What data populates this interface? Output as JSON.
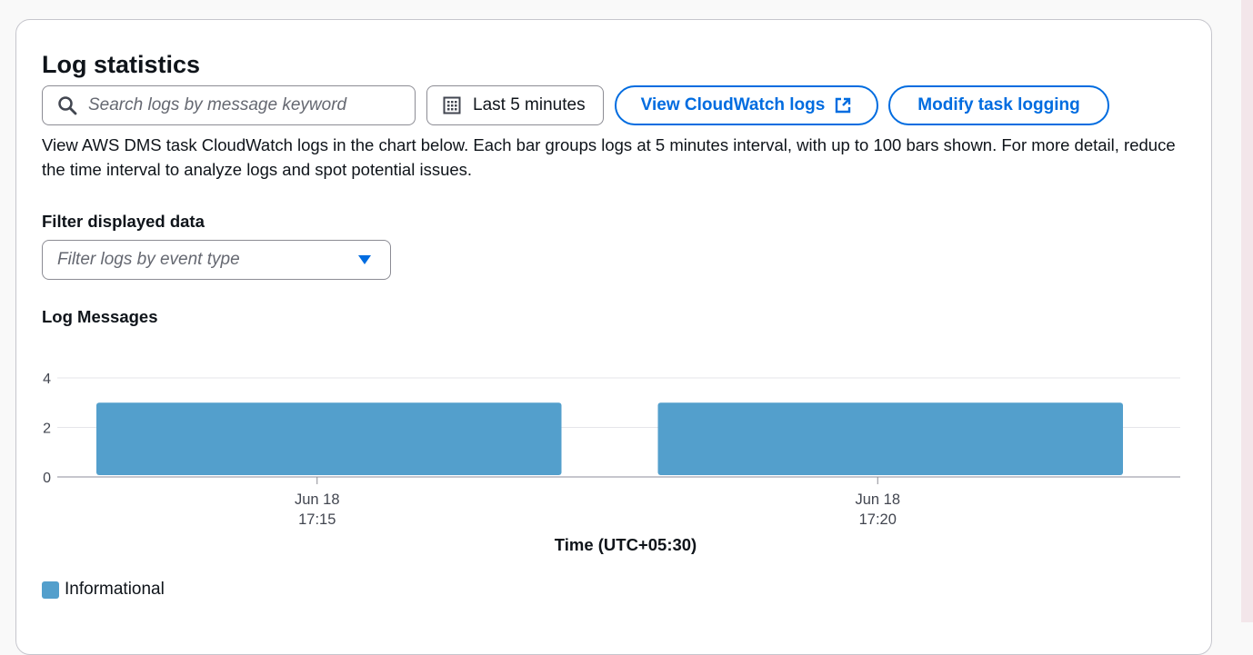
{
  "panel": {
    "title": "Log statistics",
    "description": "View AWS DMS task CloudWatch logs in the chart below. Each bar groups logs at 5 minutes interval, with up to 100 bars shown. For more detail, reduce the time interval to analyze logs and spot potential issues."
  },
  "search": {
    "placeholder": "Search logs by message keyword",
    "icon": "search-icon"
  },
  "time_range": {
    "value": "Last 5 minutes",
    "icon": "calendar-icon"
  },
  "buttons": {
    "view_cloudwatch": "View CloudWatch logs",
    "modify_logging": "Modify task logging"
  },
  "filter": {
    "label": "Filter displayed data",
    "placeholder": "Filter logs by event type"
  },
  "colors": {
    "accent": "#006ce0",
    "bar": "#539fcc"
  },
  "chart_data": {
    "type": "bar",
    "title": "Log Messages",
    "xlabel": "Time (UTC+05:30)",
    "ylabel": "",
    "ylim": [
      0,
      4
    ],
    "yticks": [
      0,
      2,
      4
    ],
    "categories": [
      "Jun 18 17:15",
      "Jun 18 17:20"
    ],
    "x_tick_labels": [
      {
        "line1": "Jun 18",
        "line2": "17:15"
      },
      {
        "line1": "Jun 18",
        "line2": "17:20"
      }
    ],
    "series": [
      {
        "name": "Informational",
        "values": [
          3,
          3
        ],
        "color": "#539fcc"
      }
    ],
    "grid": true,
    "legend": "bottom-left"
  }
}
